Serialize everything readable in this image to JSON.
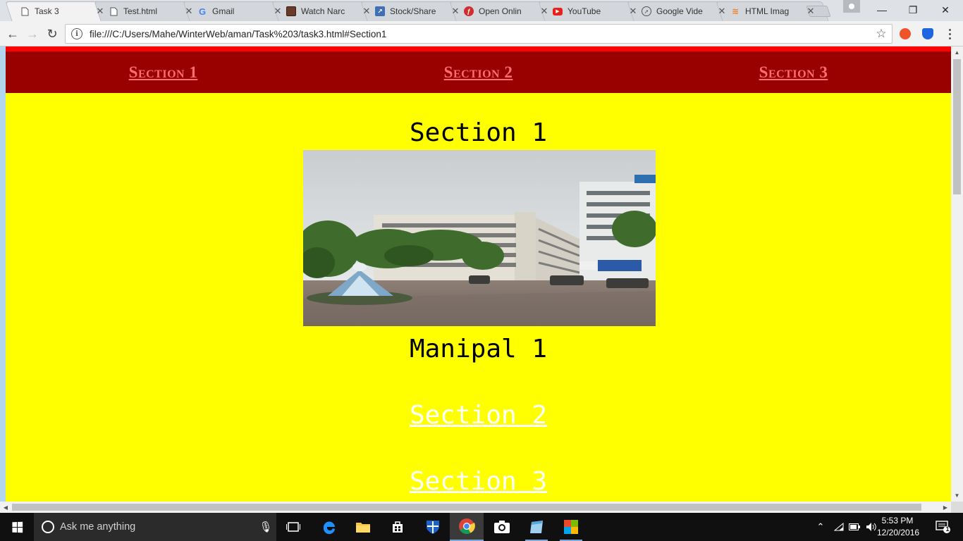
{
  "browser": {
    "tabs": [
      {
        "title": "Task 3",
        "icon": "page-icon",
        "active": true
      },
      {
        "title": "Test.html",
        "icon": "page-icon",
        "active": false
      },
      {
        "title": "Gmail",
        "icon": "google-icon",
        "active": false
      },
      {
        "title": "Watch Narc",
        "icon": "film-icon",
        "active": false
      },
      {
        "title": "Stock/Share",
        "icon": "chart-icon",
        "active": false
      },
      {
        "title": "Open Onlin",
        "icon": "pdf-icon",
        "active": false
      },
      {
        "title": "YouTube",
        "icon": "youtube-icon",
        "active": false
      },
      {
        "title": "Google Vide",
        "icon": "compass-icon",
        "active": false
      },
      {
        "title": "HTML Imag",
        "icon": "stack-icon",
        "active": false
      }
    ],
    "tab_close_glyph": "✕",
    "url": "file:///C:/Users/Mahe/WinterWeb/aman/Task%203/task3.html#Section1",
    "window_controls": {
      "minimize": "—",
      "maximize": "❐",
      "close": "✕"
    }
  },
  "page": {
    "nav": [
      {
        "label": "Section 1",
        "href": "#Section1"
      },
      {
        "label": "Section 2",
        "href": "#Section2"
      },
      {
        "label": "Section 3",
        "href": "#Section3"
      }
    ],
    "section_heading": "Section 1",
    "photo_alt": "Manipal",
    "caption": "Manipal 1",
    "links": [
      {
        "label": "Section 2",
        "href": "#Section2"
      },
      {
        "label": "Section 3",
        "href": "#Section3"
      }
    ],
    "colors": {
      "background": "#ffff00",
      "navbar": "#990000",
      "nav_link": "#ff6e6e",
      "top_border": "#ff0000",
      "link": "#ffffff"
    }
  },
  "taskbar": {
    "search_placeholder": "Ask me anything",
    "pinned": [
      "task-view-icon",
      "edge-icon",
      "file-explorer-icon",
      "store-icon",
      "defender-icon",
      "chrome-icon",
      "camera-icon",
      "notepad-icon",
      "office-icon"
    ],
    "clock_time": "5:53 PM",
    "clock_date": "12/20/2016",
    "notification_count": "1"
  }
}
